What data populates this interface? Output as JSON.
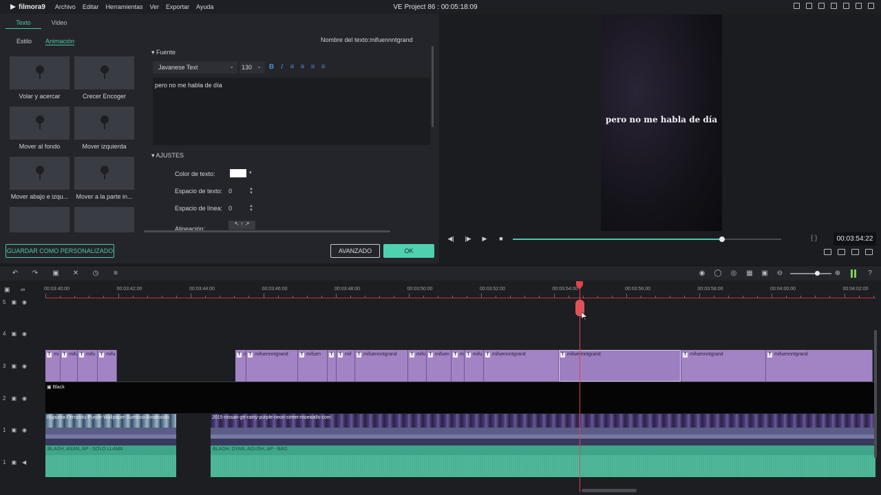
{
  "app": {
    "logo_text": "filmora9",
    "menu": [
      "Archivo",
      "Editar",
      "Herramientas",
      "Ver",
      "Exportar",
      "Ayuda"
    ],
    "window_title": "VE Project 86 : 00:05:18:09"
  },
  "editor": {
    "tabs": [
      "Texto",
      "Video"
    ],
    "subtabs": [
      "Estilo",
      "Animación"
    ],
    "presets": [
      "Volar y acercar",
      "Crecer Encoger",
      "Mover al fondo",
      "Mover izquierda",
      "Mover abajo e izqu...",
      "Mover a la parte in...",
      "",
      ""
    ],
    "text_name": "Nombre del texto:mifuennntgrand",
    "font_section": "Fuente",
    "font_name": "Javanese Text",
    "font_size": "130",
    "text_content": "pero no me habla de día",
    "settings_section": "AJUSTES",
    "color_label": "Color de texto:",
    "text_spacing_label": "Espacio de texto:",
    "text_spacing_value": "0",
    "line_spacing_label": "Espacio de línea:",
    "line_spacing_value": "0",
    "alignment_label": "Alineación:",
    "text_color": "#ffffff",
    "save_custom_label": "GUARDAR COMO PERSONALIZADO",
    "advanced_label": "AVANZADO",
    "ok_label": "OK"
  },
  "preview": {
    "overlay_text": "pero no me habla de día",
    "progress": 0.78,
    "braces": "{ }",
    "time": "00:03:54:22"
  },
  "timeline": {
    "ruler_labels": [
      "00:03:40:00",
      "00:03:42:00",
      "00:03:44:00",
      "00:03:46:00",
      "00:03:48:00",
      "00:03:50:00",
      "00:03:52:00",
      "00:03:54:00",
      "00:03:56:00",
      "00:03:58:00",
      "00:04:00:00",
      "00:04:02:00"
    ],
    "tracks": [
      "5",
      "4",
      "3",
      "2",
      "1",
      "1"
    ],
    "title_clips": [
      "mi",
      "mifu",
      "mifu",
      "mifu",
      "m",
      "mifuennntgrand",
      "mifuen",
      "m",
      "mif",
      "mifuennntgrand",
      "mifu",
      "mifuen",
      "mif",
      "mifu",
      "mifuennntgrand",
      "mifuennntgrand",
      "mifuennntgrand",
      "mifuennntgrand"
    ],
    "bg_clip": "Black",
    "video_clips": [
      "Rupuma-Ferrandu-Purple-Wallpaper-Sumisso-Amatsoulu",
      "2015-nissan-gtr-rainy-purple-neon-street-moewalls-com"
    ],
    "audio_clips": [
      "BLAGH, ASAN, AP - SOLO LLAMA",
      "BLAGH, DYAN, AGUSH, AP - BAG"
    ]
  }
}
